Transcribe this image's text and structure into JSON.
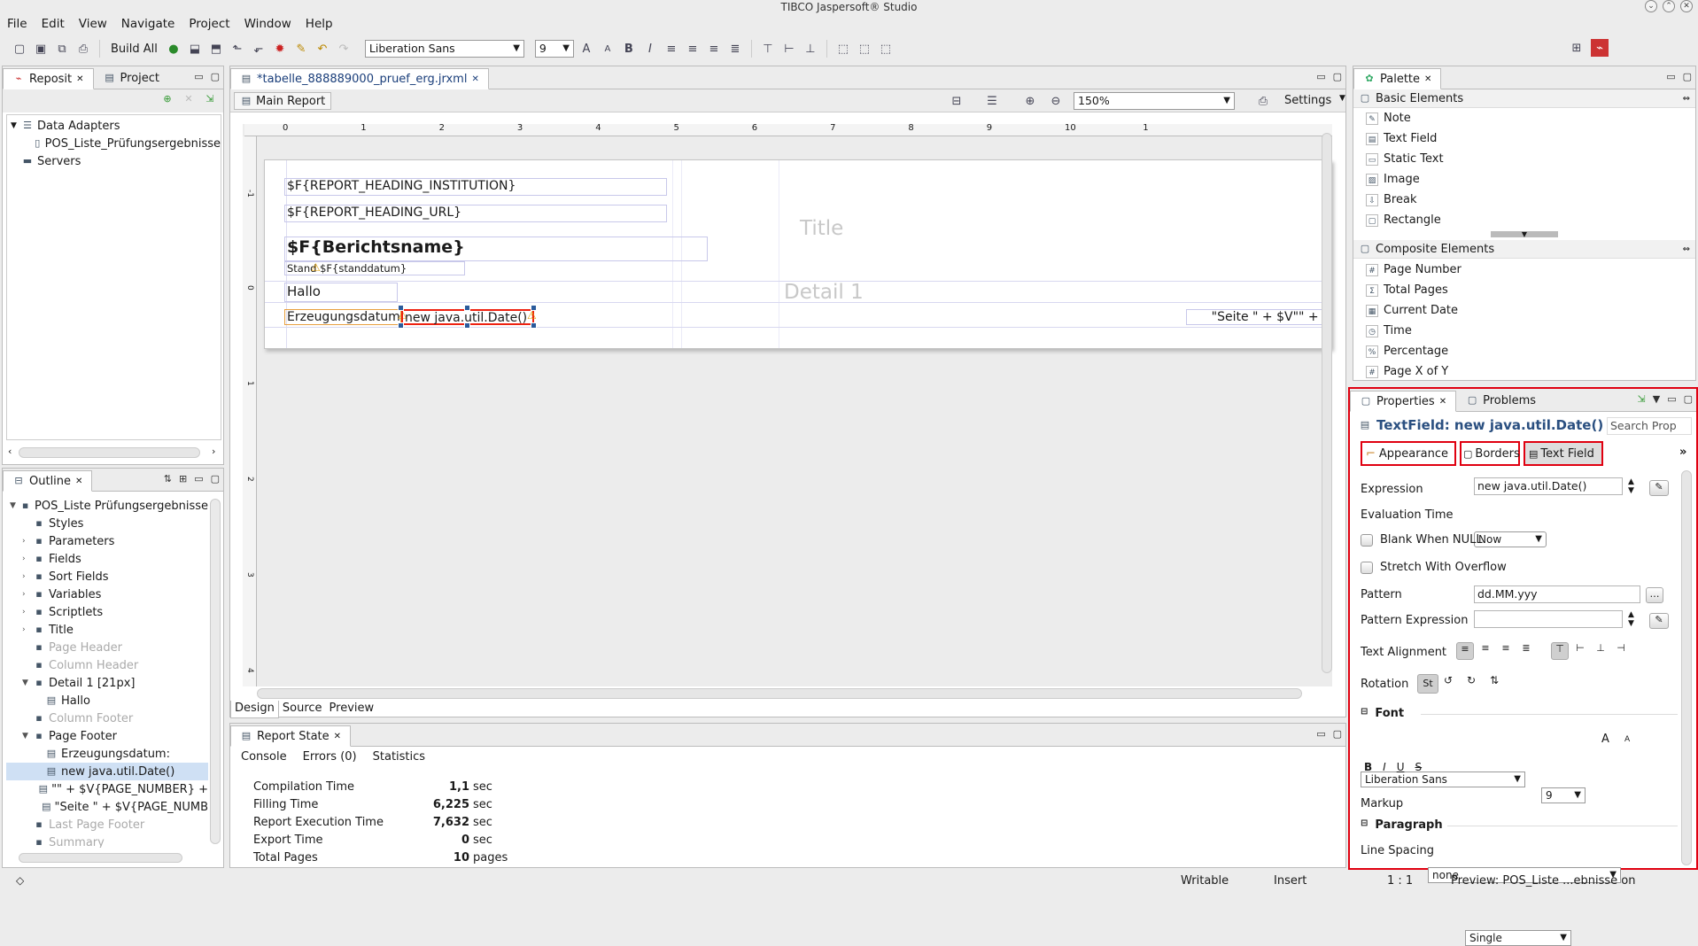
{
  "window": {
    "title": "TIBCO Jaspersoft® Studio"
  },
  "menu": [
    "File",
    "Edit",
    "View",
    "Navigate",
    "Project",
    "Window",
    "Help"
  ],
  "toolbar": {
    "build_all": "Build All",
    "font": "Liberation Sans",
    "size": "9"
  },
  "left_top": {
    "tabs": [
      "Reposit",
      "Project"
    ],
    "tree": [
      {
        "label": "Data Adapters",
        "level": 0
      },
      {
        "label": "POS_Liste_Prüfungsergebnisse",
        "level": 1
      },
      {
        "label": "Servers",
        "level": 0
      }
    ]
  },
  "outline": {
    "tab": "Outline",
    "items": [
      {
        "label": "POS_Liste Prüfungsergebnisse",
        "level": 0,
        "muted": false
      },
      {
        "label": "Styles",
        "level": 1,
        "muted": false
      },
      {
        "label": "Parameters",
        "level": 1,
        "muted": false
      },
      {
        "label": "Fields",
        "level": 1,
        "muted": false
      },
      {
        "label": "Sort Fields",
        "level": 1,
        "muted": false
      },
      {
        "label": "Variables",
        "level": 1,
        "muted": false
      },
      {
        "label": "Scriptlets",
        "level": 1,
        "muted": false
      },
      {
        "label": "Title",
        "level": 1,
        "muted": false
      },
      {
        "label": "Page Header",
        "level": 1,
        "muted": true
      },
      {
        "label": "Column Header",
        "level": 1,
        "muted": true
      },
      {
        "label": "Detail 1  [21px]",
        "level": 1,
        "muted": false
      },
      {
        "label": "Hallo",
        "level": 2,
        "muted": false
      },
      {
        "label": "Column Footer",
        "level": 1,
        "muted": true
      },
      {
        "label": "Page Footer",
        "level": 1,
        "muted": false
      },
      {
        "label": "Erzeugungsdatum:",
        "level": 2,
        "muted": false
      },
      {
        "label": "new java.util.Date()",
        "level": 2,
        "muted": false,
        "selected": true
      },
      {
        "label": "\"\" + $V{PAGE_NUMBER} +",
        "level": 2,
        "muted": false
      },
      {
        "label": "\"Seite \" + $V{PAGE_NUMB",
        "level": 2,
        "muted": false
      },
      {
        "label": "Last Page Footer",
        "level": 1,
        "muted": true
      },
      {
        "label": "Summary",
        "level": 1,
        "muted": true
      }
    ]
  },
  "editor": {
    "tab": "*tabelle_888889000_pruef_erg.jrxml",
    "main_report": "Main Report",
    "zoom": "150%",
    "settings": "Settings",
    "ruler": [
      "0",
      "1",
      "2",
      "3",
      "4",
      "5",
      "6",
      "7",
      "8",
      "9",
      "10",
      "1"
    ],
    "vruler": [
      "-1",
      "0",
      "1",
      "2",
      "3",
      "4"
    ],
    "band_title": "Title",
    "band_detail": "Detail 1",
    "fields": {
      "heading_inst": "$F{REPORT_HEADING_INSTITUTION}",
      "heading_url": "$F{REPORT_HEADING_URL}",
      "berichtsname": "$F{Berichtsname}",
      "stand": "Stand $F{standdatum}",
      "hallo": "Hallo",
      "erzeugung": "Erzeugungsdatum:",
      "date": "new java.util.Date()",
      "seite": "\"Seite \" + $V\"\" + $"
    },
    "bottom_tabs": [
      "Design",
      "Source",
      "Preview"
    ]
  },
  "report_state": {
    "tab": "Report State",
    "subtabs": [
      "Console",
      "Errors (0)",
      "Statistics"
    ],
    "rows": [
      {
        "label": "Compilation Time",
        "value": "1,1",
        "unit": "sec"
      },
      {
        "label": "Filling Time",
        "value": "6,225",
        "unit": "sec"
      },
      {
        "label": "Report Execution Time",
        "value": "7,632",
        "unit": "sec"
      },
      {
        "label": "Export Time",
        "value": "0",
        "unit": "sec"
      },
      {
        "label": "Total Pages",
        "value": "10",
        "unit": "pages"
      }
    ]
  },
  "palette": {
    "tab": "Palette",
    "basic_header": "Basic Elements",
    "basic": [
      "Note",
      "Text Field",
      "Static Text",
      "Image",
      "Break",
      "Rectangle"
    ],
    "composite_header": "Composite Elements",
    "composite": [
      "Page Number",
      "Total Pages",
      "Current Date",
      "Time",
      "Percentage",
      "Page X of Y"
    ]
  },
  "properties": {
    "tabs": [
      "Properties",
      "Problems"
    ],
    "title": "TextField: new java.util.Date()",
    "search": "Search Prop",
    "subtabs": [
      "Appearance",
      "Borders",
      "Text Field"
    ],
    "expression_label": "Expression",
    "expression": "new java.util.Date()",
    "eval_label": "Evaluation Time",
    "eval": "Now",
    "blank_null": "Blank When NULL",
    "stretch": "Stretch With Overflow",
    "pattern_label": "Pattern",
    "pattern": "dd.MM.yyy",
    "pattern_expr_label": "Pattern Expression",
    "pattern_expr": "",
    "align_label": "Text Alignment",
    "rotation_label": "Rotation",
    "rotation_val": "St",
    "font_section": "Font",
    "font": "Liberation Sans",
    "size": "9",
    "markup_label": "Markup",
    "markup": "none",
    "paragraph_section": "Paragraph",
    "spacing_label": "Line Spacing",
    "spacing": "Single"
  },
  "status": {
    "writable": "Writable",
    "insert": "Insert",
    "pos": "1 : 1",
    "preview": "Preview: POS_Liste ...ebnisse on"
  }
}
